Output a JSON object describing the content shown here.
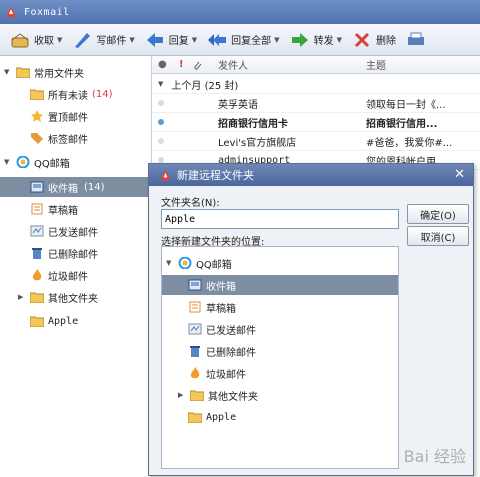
{
  "app": {
    "title": "Foxmail"
  },
  "toolbar": {
    "receive": "收取",
    "compose": "写邮件",
    "reply": "回复",
    "reply_all": "回复全部",
    "forward": "转发",
    "delete": "删除"
  },
  "sidebar": {
    "common_folders": "常用文件夹",
    "all_unread": "所有未读",
    "all_unread_count": "(14)",
    "pinned": "置顶邮件",
    "tagged": "标签邮件",
    "account": "QQ邮箱",
    "inbox": "收件箱",
    "inbox_count": "(14)",
    "drafts": "草稿箱",
    "sent": "已发送邮件",
    "deleted": "已删除邮件",
    "junk": "垃圾邮件",
    "other": "其他文件夹",
    "apple": "Apple"
  },
  "maillist": {
    "col_sender": "发件人",
    "col_subject": "主题",
    "group_label": "上个月 (25 封)",
    "rows": [
      {
        "sender": "英孚英语",
        "subject": "领取每日一封《..."
      },
      {
        "sender": "招商银行信用卡",
        "subject": "招商银行信用..."
      },
      {
        "sender": "Levi's官方旗舰店",
        "subject": "#爸爸，我爱你#..."
      },
      {
        "sender": "adminsupport",
        "subject": "您的恩科帐户用..."
      }
    ]
  },
  "dialog": {
    "title": "新建远程文件夹",
    "name_label": "文件夹名(N):",
    "name_value": "Apple",
    "location_label": "选择新建文件夹的位置:",
    "ok": "确定(O)",
    "cancel": "取消(C)",
    "tree": {
      "account": "QQ邮箱",
      "inbox": "收件箱",
      "drafts": "草稿箱",
      "sent": "已发送邮件",
      "deleted": "已删除邮件",
      "junk": "垃圾邮件",
      "other": "其他文件夹",
      "apple": "Apple"
    }
  },
  "watermark": "Bai 经验",
  "colors": {
    "titlebar": "#4f72b0",
    "selection": "#7d8ea3",
    "unread_count": "#d9403a",
    "unread_dot": "#5b9bd8"
  }
}
